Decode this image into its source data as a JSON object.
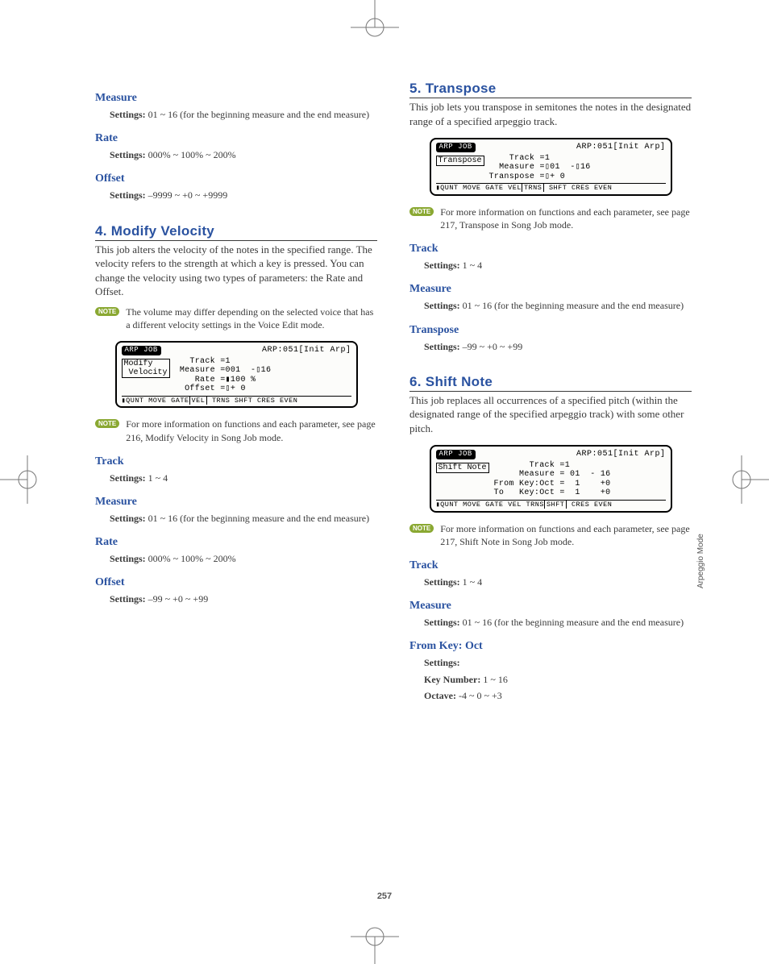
{
  "sideLabel": "Arpeggio Mode",
  "pageNumber": "257",
  "left": {
    "p1": {
      "title": "Measure",
      "setting": "01 ~ 16 (for the beginning measure and the end measure)"
    },
    "p2": {
      "title": "Rate",
      "setting": "000% ~ 100% ~ 200%"
    },
    "p3": {
      "title": "Offset",
      "setting": "–9999 ~ +0 ~ +9999"
    },
    "sec4": {
      "heading": "4. Modify Velocity",
      "body": "This job alters the velocity of the notes in the specified range. The velocity refers to the strength at which a key is pressed. You can change the velocity using two types of parameters: the Rate and Offset.",
      "note1": "The volume may differ depending on the selected voice that has a different velocity settings in the Voice Edit mode.",
      "lcd": {
        "headerLeft": "ARP JOB",
        "headerRight": "ARP:051[Init Arp]",
        "box": "Modify\n Velocity",
        "params": "   Track =1\n Measure =001  -▯16\n    Rate =▮100 %\n  Offset =▯+ 0",
        "tabs": "▮QUNT MOVE GATE VEL  TRNS SHFT CRES EVEN",
        "sel": "VEL"
      },
      "note2": "For more information on functions and each parameter, see page 216, Modify Velocity in Song Job mode.",
      "track": {
        "title": "Track",
        "setting": "1 ~ 4"
      },
      "measure": {
        "title": "Measure",
        "setting": "01 ~ 16 (for the beginning measure and the end measure)"
      },
      "rate": {
        "title": "Rate",
        "setting": "000% ~ 100% ~ 200%"
      },
      "offset": {
        "title": "Offset",
        "setting": "–99 ~ +0 ~ +99"
      }
    }
  },
  "right": {
    "sec5": {
      "heading": "5. Transpose",
      "body": "This job lets you transpose in semitones the notes in the designated range of a specified arpeggio track.",
      "lcd": {
        "headerLeft": "ARP JOB",
        "headerRight": "ARP:051[Init Arp]",
        "box": "Transpose",
        "params": "    Track =1\n  Measure =▯01  -▯16\nTranspose =▯+ 0",
        "tabs": "▮QUNT MOVE GATE VEL TRNS  SHFT CRES EVEN",
        "sel": "TRNS"
      },
      "note": "For more information on functions and each parameter, see page 217, Transpose in Song Job mode.",
      "track": {
        "title": "Track",
        "setting": "1 ~ 4"
      },
      "measure": {
        "title": "Measure",
        "setting": "01 ~ 16 (for the beginning measure and the end measure)"
      },
      "transpose": {
        "title": "Transpose",
        "setting": "–99 ~ +0 ~ +99"
      }
    },
    "sec6": {
      "heading": "6. Shift Note",
      "body": "This job replaces all occurrences of a specified pitch (within the designated range of the specified arpeggio track) with some other pitch.",
      "lcd": {
        "headerLeft": "ARP JOB",
        "headerRight": "ARP:051[Init Arp]",
        "box": "Shift Note",
        "params": "       Track =1\n     Measure = 01  - 16\nFrom Key:Oct =  1    +0\nTo   Key:Oct =  1    +0",
        "tabs": "▮QUNT MOVE GATE VEL TRNS SHFT  CRES EVEN",
        "sel": "SHFT"
      },
      "note": "For more information on functions and each parameter, see page 217, Shift Note in Song Job mode.",
      "track": {
        "title": "Track",
        "setting": "1 ~ 4"
      },
      "measure": {
        "title": "Measure",
        "setting": "01 ~ 16 (for the beginning measure and the end measure)"
      },
      "fromKey": {
        "title": "From Key: Oct",
        "settings": "Settings:",
        "keyNumLabel": "Key Number:",
        "keyNum": "1 ~ 16",
        "octaveLabel": "Octave:",
        "octave": "-4 ~ 0 ~ +3"
      }
    }
  },
  "labels": {
    "settings": "Settings:",
    "note": "NOTE"
  }
}
